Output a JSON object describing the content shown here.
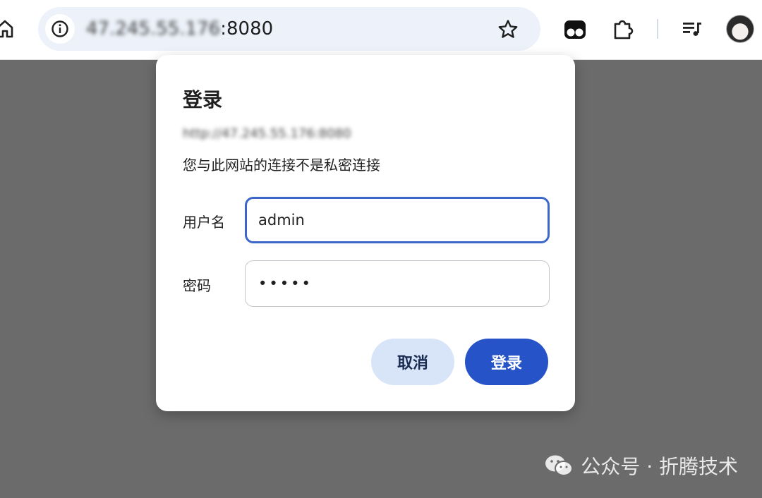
{
  "browser": {
    "url_host": "47.245.55.176",
    "url_port": ":8080",
    "icons": {
      "home": "home-icon",
      "info": "info-icon",
      "star": "star-icon",
      "tampermonkey": "tampermonkey-icon",
      "extensions": "puzzle-icon",
      "media": "media-queue-icon",
      "profile": "profile-avatar"
    }
  },
  "dialog": {
    "title": "登录",
    "origin": "http://47.245.55.176:8080",
    "note": "您与此网站的连接不是私密连接",
    "username_label": "用户名",
    "username_value": "admin",
    "password_label": "密码",
    "password_value": "•••••",
    "cancel_label": "取消",
    "login_label": "登录"
  },
  "watermark": {
    "text": "公众号 · 折腾技术",
    "icon": "wechat-icon"
  },
  "colors": {
    "accent": "#2653c8",
    "focus_border": "#3c66c8",
    "secondary_button": "#d8e4f8",
    "overlay": "#6b6b6b",
    "omnibox": "#edf2fa"
  }
}
